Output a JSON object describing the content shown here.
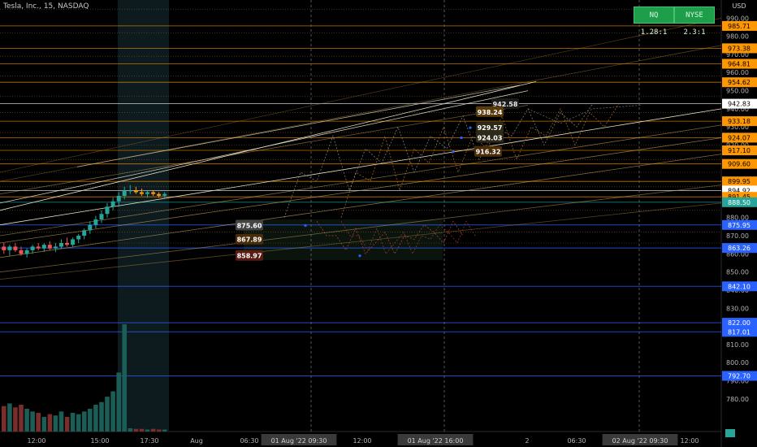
{
  "header": {
    "symbol_title": "Tesla, Inc., 15, NASDAQ",
    "currency": "USD"
  },
  "breadth": {
    "nq_label": "NQ 1.28:1",
    "nyse_label": "NYSE 2.3:1",
    "color": "#1e9e4a"
  },
  "colors": {
    "orange": "#ff9800",
    "blue": "#2962ff",
    "green_badge": "#26a69a",
    "up": "#26a69a",
    "down": "#ef5350"
  },
  "chart_data": {
    "type": "line",
    "title": "",
    "ylim": [
      762,
      1000
    ],
    "y_ticks": [
      780,
      790,
      800,
      810,
      820,
      830,
      840,
      850,
      860,
      870,
      880,
      890,
      900,
      910,
      920,
      930,
      940,
      950,
      960,
      970,
      980,
      990
    ],
    "x_tick_labels": [
      "12:00",
      "15:00",
      "17:30",
      "Aug",
      "06:30",
      "01 Aug '22 09:30",
      "12:00",
      "01 Aug '22 16:00",
      "2",
      "06:30",
      "02 Aug '22 09:30",
      "12:00"
    ],
    "price_levels": [
      {
        "value": 985.71,
        "color": "orange"
      },
      {
        "value": 973.38,
        "color": "orange"
      },
      {
        "value": 964.81,
        "color": "orange"
      },
      {
        "value": 954.62,
        "color": "orange"
      },
      {
        "value": 942.83,
        "color": "white"
      },
      {
        "value": 933.18,
        "color": "orange"
      },
      {
        "value": 924.07,
        "color": "orange"
      },
      {
        "value": 917.1,
        "color": "orange"
      },
      {
        "value": 909.6,
        "color": "orange"
      },
      {
        "value": 899.95,
        "color": "orange"
      },
      {
        "value": 894.92,
        "color": "white"
      },
      {
        "value": 891.45,
        "color": "orange"
      },
      {
        "value": 888.5,
        "color": "green"
      },
      {
        "value": 875.95,
        "color": "blue"
      },
      {
        "value": 863.26,
        "color": "blue"
      },
      {
        "value": 842.1,
        "color": "blue"
      },
      {
        "value": 822.0,
        "color": "blue"
      },
      {
        "value": 817.01,
        "color": "blue"
      },
      {
        "value": 792.7,
        "color": "blue"
      }
    ],
    "level_labels": [
      {
        "text": "985.71"
      },
      {
        "text": "973.38"
      },
      {
        "text": "964.81"
      },
      {
        "text": "954.62"
      },
      {
        "text": "942.83"
      },
      {
        "text": "933.18"
      },
      {
        "text": "924.07"
      },
      {
        "text": "917.10"
      },
      {
        "text": "909.60"
      },
      {
        "text": "899.95"
      },
      {
        "text": "894.92"
      },
      {
        "text": "891.45"
      },
      {
        "text": "888.50"
      },
      {
        "text": "875.95"
      },
      {
        "text": "863.26"
      },
      {
        "text": "842.10"
      },
      {
        "text": "822.00"
      },
      {
        "text": "817.01"
      },
      {
        "text": "792.70"
      }
    ],
    "target_labels": [
      {
        "text": "942.58",
        "value": 942.58
      },
      {
        "text": "938.24",
        "value": 938.24
      },
      {
        "text": "929.57",
        "value": 929.57
      },
      {
        "text": "924.03",
        "value": 924.03
      },
      {
        "text": "916.32",
        "value": 916.32
      },
      {
        "text": "875.60",
        "value": 875.6
      },
      {
        "text": "867.89",
        "value": 867.89
      },
      {
        "text": "858.97",
        "value": 858.97
      }
    ],
    "candles": [
      {
        "o": 864,
        "h": 866,
        "l": 860,
        "c": 862
      },
      {
        "o": 862,
        "h": 865,
        "l": 859,
        "c": 864
      },
      {
        "o": 864,
        "h": 866,
        "l": 861,
        "c": 862
      },
      {
        "o": 862,
        "h": 864,
        "l": 859,
        "c": 860
      },
      {
        "o": 860,
        "h": 863,
        "l": 858,
        "c": 862
      },
      {
        "o": 862,
        "h": 865,
        "l": 860,
        "c": 864
      },
      {
        "o": 864,
        "h": 866,
        "l": 862,
        "c": 863
      },
      {
        "o": 863,
        "h": 866,
        "l": 861,
        "c": 865
      },
      {
        "o": 865,
        "h": 867,
        "l": 862,
        "c": 863
      },
      {
        "o": 863,
        "h": 866,
        "l": 861,
        "c": 864
      },
      {
        "o": 864,
        "h": 868,
        "l": 863,
        "c": 866
      },
      {
        "o": 866,
        "h": 869,
        "l": 864,
        "c": 865
      },
      {
        "o": 865,
        "h": 869,
        "l": 864,
        "c": 868
      },
      {
        "o": 868,
        "h": 871,
        "l": 866,
        "c": 870
      },
      {
        "o": 870,
        "h": 874,
        "l": 868,
        "c": 873
      },
      {
        "o": 873,
        "h": 878,
        "l": 871,
        "c": 876
      },
      {
        "o": 876,
        "h": 881,
        "l": 874,
        "c": 879
      },
      {
        "o": 879,
        "h": 884,
        "l": 877,
        "c": 882
      },
      {
        "o": 882,
        "h": 888,
        "l": 880,
        "c": 886
      },
      {
        "o": 886,
        "h": 891,
        "l": 884,
        "c": 889
      },
      {
        "o": 889,
        "h": 894,
        "l": 886,
        "c": 892
      },
      {
        "o": 892,
        "h": 897,
        "l": 890,
        "c": 895
      },
      {
        "o": 895,
        "h": 898,
        "l": 893,
        "c": 895
      },
      {
        "o": 895,
        "h": 897,
        "l": 893,
        "c": 894
      },
      {
        "o": 894,
        "h": 896,
        "l": 892,
        "c": 893
      },
      {
        "o": 893,
        "h": 895,
        "l": 891,
        "c": 894
      },
      {
        "o": 894,
        "h": 895,
        "l": 892,
        "c": 893
      },
      {
        "o": 893,
        "h": 894,
        "l": 891,
        "c": 892
      },
      {
        "o": 892,
        "h": 894,
        "l": 891,
        "c": 893
      }
    ],
    "volume": [
      38,
      42,
      36,
      40,
      34,
      30,
      28,
      22,
      26,
      24,
      30,
      22,
      28,
      26,
      30,
      34,
      40,
      44,
      52,
      60,
      88,
      160,
      5,
      4,
      4,
      3,
      4,
      3,
      3
    ],
    "projection_bullish": [
      [
        880,
        905
      ],
      [
        900,
        925
      ],
      [
        895,
        918
      ],
      [
        910,
        930
      ],
      [
        905,
        925
      ],
      [
        918,
        936
      ],
      [
        912,
        930
      ],
      [
        925,
        940
      ],
      [
        920,
        938
      ],
      [
        930,
        943
      ]
    ],
    "projection_bearish": [
      [
        878,
        870
      ],
      [
        870,
        862
      ],
      [
        874,
        860
      ],
      [
        866,
        872
      ],
      [
        860,
        870
      ],
      [
        868,
        876
      ],
      [
        872,
        866
      ],
      [
        878,
        870
      ]
    ]
  }
}
